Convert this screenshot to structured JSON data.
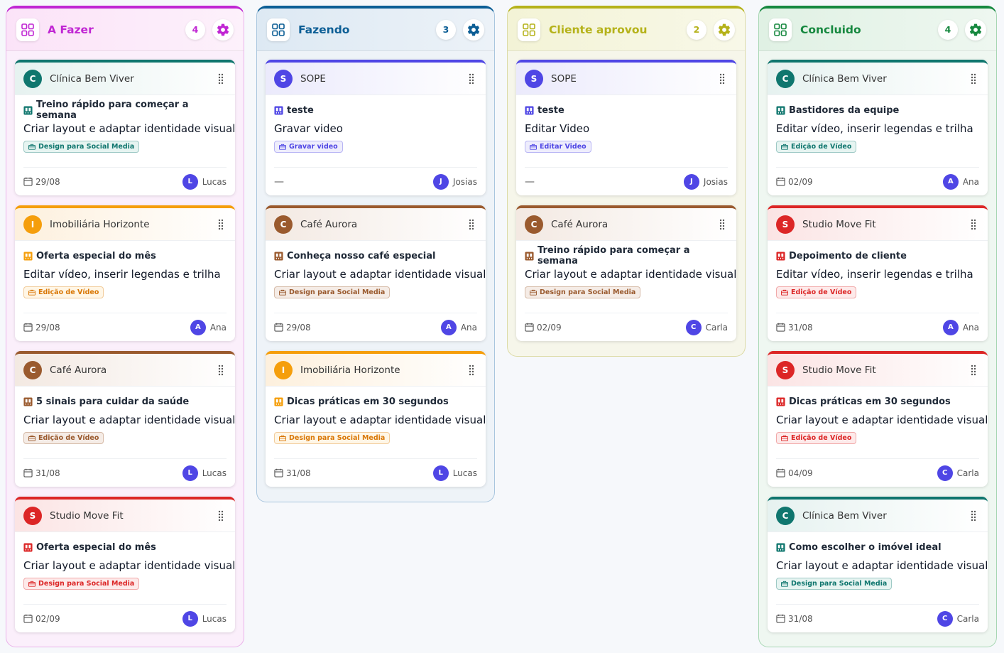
{
  "columns": [
    {
      "id": "col-afazer",
      "title": "A Fazer",
      "count": "4",
      "color": "#c026d3",
      "bg": "#fbeffb",
      "header_bg": "linear-gradient(90deg,#fbe3f8,#fdf1fb)",
      "border": "#eab3ea",
      "cards": [
        {
          "client": "Clínica Bem Viver",
          "initial": "C",
          "client_color": "#0f766e",
          "post": "Treino rápido para começar a semana",
          "task": "Criar layout e adaptar identidade visual",
          "tag": "Design para Social Media",
          "tag_color": "#0f766e",
          "tag_bg": "#e6f4f1",
          "date": "29/08",
          "assignee": "Lucas",
          "assignee_initial": "L",
          "head_bg": "linear-gradient(90deg,#e6f2f0,#ffffff)"
        },
        {
          "client": "Imobiliária Horizonte",
          "initial": "I",
          "client_color": "#f59e0b",
          "post": "Oferta especial do mês",
          "task": "Editar vídeo, inserir legendas e trilha",
          "tag": "Edição de Vídeo",
          "tag_color": "#d97706",
          "tag_bg": "#fff6e6",
          "date": "29/08",
          "assignee": "Ana",
          "assignee_initial": "A",
          "head_bg": "linear-gradient(90deg,#fdf0dd,#ffffff)"
        },
        {
          "client": "Café Aurora",
          "initial": "C",
          "client_color": "#9a5a2e",
          "post": "5 sinais para cuidar da saúde",
          "task": "Criar layout e adaptar identidade visual",
          "tag": "Edição de Vídeo",
          "tag_color": "#9a5a2e",
          "tag_bg": "#f5ece6",
          "date": "31/08",
          "assignee": "Lucas",
          "assignee_initial": "L",
          "head_bg": "linear-gradient(90deg,#f3e9e2,#ffffff)"
        },
        {
          "client": "Studio Move Fit",
          "initial": "S",
          "client_color": "#dc2626",
          "post": "Oferta especial do mês",
          "task": "Criar layout e adaptar identidade visual",
          "tag": "Design para Social Media",
          "tag_color": "#dc2626",
          "tag_bg": "#fdeaea",
          "date": "02/09",
          "assignee": "Lucas",
          "assignee_initial": "L",
          "head_bg": "linear-gradient(90deg,#fbe4e4,#ffffff)"
        }
      ]
    },
    {
      "id": "col-fazendo",
      "title": "Fazendo",
      "count": "3",
      "color": "#0c5e95",
      "bg": "#eef3f8",
      "header_bg": "linear-gradient(90deg,#dde9f3,#ecf2f8)",
      "border": "#a9c6de",
      "cards": [
        {
          "client": "SOPE",
          "initial": "S",
          "client_color": "#4f46e5",
          "post": "teste",
          "task": "Gravar video",
          "tag": "Gravar video",
          "tag_color": "#4f46e5",
          "tag_bg": "#eeedfc",
          "date": "",
          "assignee": "Josias",
          "assignee_initial": "J",
          "head_bg": "linear-gradient(90deg,#ebeafc,#ffffff)"
        },
        {
          "client": "Café Aurora",
          "initial": "C",
          "client_color": "#9a5a2e",
          "post": "Conheça nosso café especial",
          "task": "Criar layout e adaptar identidade visual",
          "tag": "Design para Social Media",
          "tag_color": "#9a5a2e",
          "tag_bg": "#f5ece6",
          "date": "29/08",
          "assignee": "Ana",
          "assignee_initial": "A",
          "head_bg": "linear-gradient(90deg,#f3e9e2,#ffffff)"
        },
        {
          "client": "Imobiliária Horizonte",
          "initial": "I",
          "client_color": "#f59e0b",
          "post": "Dicas práticas em 30 segundos",
          "task": "Criar layout e adaptar identidade visual",
          "tag": "Design para Social Media",
          "tag_color": "#d97706",
          "tag_bg": "#fff6e6",
          "date": "31/08",
          "assignee": "Lucas",
          "assignee_initial": "L",
          "head_bg": "linear-gradient(90deg,#fdf0dd,#ffffff)"
        }
      ]
    },
    {
      "id": "col-cliente",
      "title": "Cliente aprovou",
      "count": "2",
      "color": "#b5b21a",
      "bg": "#f6f6ea",
      "header_bg": "linear-gradient(90deg,#f3f3d6,#f8f8e8)",
      "border": "#dcdba6",
      "cards": [
        {
          "client": "SOPE",
          "initial": "S",
          "client_color": "#4f46e5",
          "post": "teste",
          "task": "Editar Video",
          "tag": "Editar Video",
          "tag_color": "#4f46e5",
          "tag_bg": "#eeedfc",
          "date": "",
          "assignee": "Josias",
          "assignee_initial": "J",
          "head_bg": "linear-gradient(90deg,#ebeafc,#ffffff)"
        },
        {
          "client": "Café Aurora",
          "initial": "C",
          "client_color": "#9a5a2e",
          "post": "Treino rápido para começar a semana",
          "task": "Criar layout e adaptar identidade visual",
          "tag": "Design para Social Media",
          "tag_color": "#9a5a2e",
          "tag_bg": "#f5ece6",
          "date": "02/09",
          "assignee": "Carla",
          "assignee_initial": "C",
          "head_bg": "linear-gradient(90deg,#f3e9e2,#ffffff)"
        }
      ]
    },
    {
      "id": "col-concluido",
      "title": "Concluido",
      "count": "4",
      "color": "#16883f",
      "bg": "#eff7f1",
      "header_bg": "linear-gradient(90deg,#e0f1e4,#eef7f0)",
      "border": "#a8d7b4",
      "cards": [
        {
          "client": "Clínica Bem Viver",
          "initial": "C",
          "client_color": "#0f766e",
          "post": "Bastidores da equipe",
          "task": "Editar vídeo, inserir legendas e trilha",
          "tag": "Edição de Vídeo",
          "tag_color": "#0f766e",
          "tag_bg": "#e6f4f1",
          "date": "02/09",
          "assignee": "Ana",
          "assignee_initial": "A",
          "head_bg": "linear-gradient(90deg,#e6f2f0,#ffffff)"
        },
        {
          "client": "Studio Move Fit",
          "initial": "S",
          "client_color": "#dc2626",
          "post": "Depoimento de cliente",
          "task": "Editar vídeo, inserir legendas e trilha",
          "tag": "Edição de Vídeo",
          "tag_color": "#dc2626",
          "tag_bg": "#fdeaea",
          "date": "31/08",
          "assignee": "Ana",
          "assignee_initial": "A",
          "head_bg": "linear-gradient(90deg,#fbe4e4,#ffffff)"
        },
        {
          "client": "Studio Move Fit",
          "initial": "S",
          "client_color": "#dc2626",
          "post": "Dicas práticas em 30 segundos",
          "task": "Criar layout e adaptar identidade visual",
          "tag": "Edição de Vídeo",
          "tag_color": "#dc2626",
          "tag_bg": "#fdeaea",
          "date": "04/09",
          "assignee": "Carla",
          "assignee_initial": "C",
          "head_bg": "linear-gradient(90deg,#fbe4e4,#ffffff)"
        },
        {
          "client": "Clínica Bem Viver",
          "initial": "C",
          "client_color": "#0f766e",
          "post": "Como escolher o imóvel ideal",
          "task": "Criar layout e adaptar identidade visual",
          "tag": "Design para Social Media",
          "tag_color": "#0f766e",
          "tag_bg": "#e6f4f1",
          "date": "31/08",
          "assignee": "Carla",
          "assignee_initial": "C",
          "head_bg": "linear-gradient(90deg,#e6f2f0,#ffffff)"
        }
      ]
    }
  ],
  "icons": {
    "column": "board-icon",
    "settings": "gear-icon",
    "drag": "drag-handle-icon",
    "post": "film-icon",
    "tag": "briefcase-icon",
    "date": "calendar-icon"
  },
  "no_date_text": "—"
}
